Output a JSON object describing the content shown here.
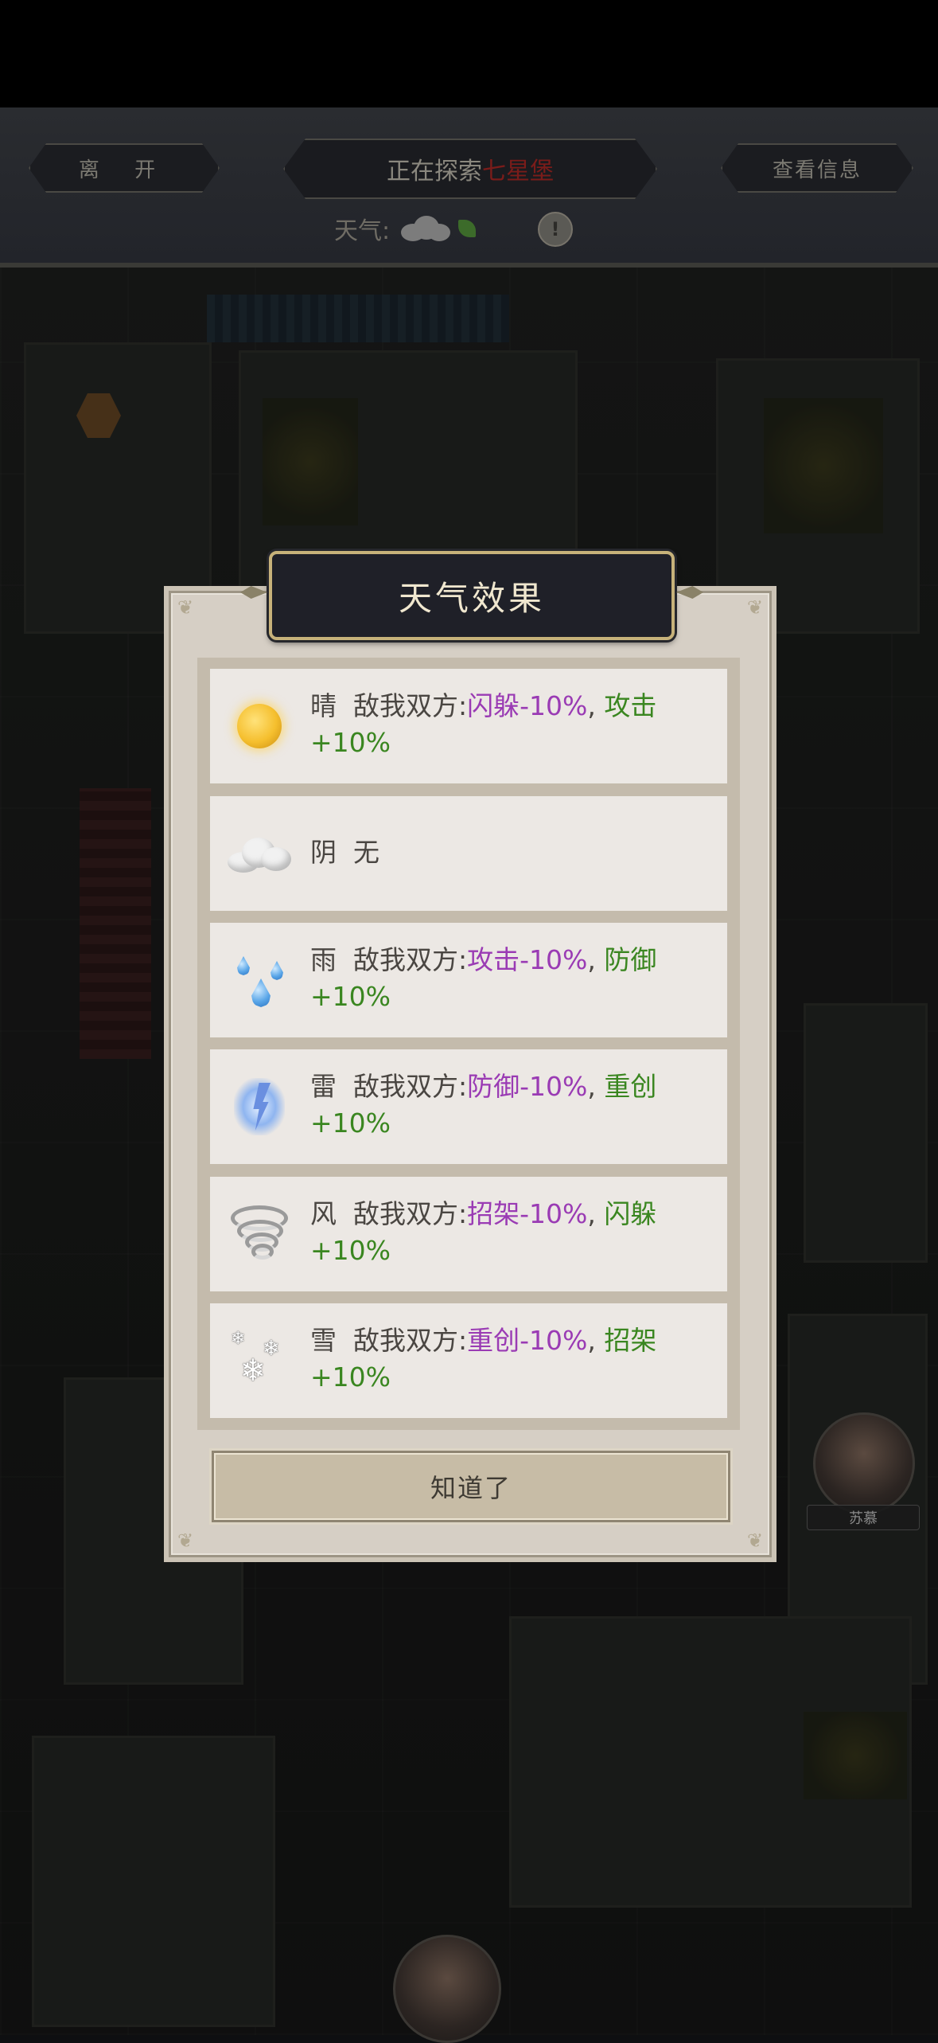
{
  "header": {
    "leave_label": "离 开",
    "exploring_prefix": "正在探索",
    "location": "七星堡",
    "info_label": "查看信息",
    "weather_label": "天气:",
    "hint_symbol": "!"
  },
  "modal": {
    "title": "天气效果",
    "confirm_label": "知道了",
    "rows": [
      {
        "icon": "sun-icon",
        "name": "晴",
        "prefix": "敌我双方:",
        "neg": "闪躲-10%",
        "sep": ",",
        "pos_a": "攻击",
        "pos_b": "+10%"
      },
      {
        "icon": "cloud-icon",
        "name": "阴",
        "effect": "无"
      },
      {
        "icon": "rain-icon",
        "name": "雨",
        "prefix": "敌我双方:",
        "neg": "攻击-10%",
        "sep": ",",
        "pos_a": "防御",
        "pos_b": "+10%"
      },
      {
        "icon": "thunder-icon",
        "name": "雷",
        "prefix": "敌我双方:",
        "neg": "防御-10%",
        "sep": ",",
        "pos_a": "重创",
        "pos_b": "+10%"
      },
      {
        "icon": "wind-icon",
        "name": "风",
        "prefix": "敌我双方:",
        "neg": "招架-10%",
        "sep": ",",
        "pos_a": "闪躲",
        "pos_b": "+10%"
      },
      {
        "icon": "snow-icon",
        "name": "雪",
        "prefix": "敌我双方:",
        "neg": "重创-10%",
        "sep": ",",
        "pos_a": "招架",
        "pos_b": "+10%"
      }
    ]
  },
  "characters": [
    {
      "name": "苏慕"
    }
  ],
  "colors": {
    "negative": "#9a3bb4",
    "positive": "#3a8620",
    "location": "#7a1c1a"
  }
}
